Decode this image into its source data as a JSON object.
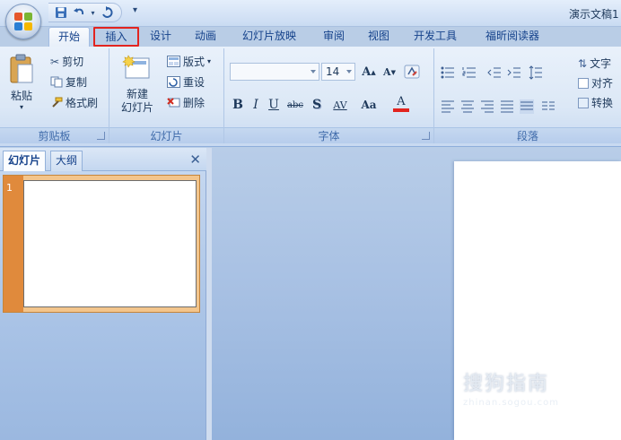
{
  "app": {
    "document_title": "演示文稿1",
    "quick_access": [
      "save-icon",
      "undo-icon",
      "redo-icon",
      "customize-qat-icon"
    ]
  },
  "tabs": [
    {
      "label": "开始",
      "active": true
    },
    {
      "label": "插入",
      "highlighted": true
    },
    {
      "label": "设计"
    },
    {
      "label": "动画"
    },
    {
      "label": "幻灯片放映"
    },
    {
      "label": "审阅"
    },
    {
      "label": "视图"
    },
    {
      "label": "开发工具"
    },
    {
      "label": "福昕阅读器"
    }
  ],
  "ribbon": {
    "clipboard": {
      "group_label": "剪贴板",
      "paste_label": "粘贴",
      "cut_label": "剪切",
      "copy_label": "复制",
      "format_painter_label": "格式刷"
    },
    "slides": {
      "group_label": "幻灯片",
      "new_slide_line1": "新建",
      "new_slide_line2": "幻灯片",
      "layout_label": "版式",
      "reset_label": "重设",
      "delete_label": "删除"
    },
    "font": {
      "group_label": "字体",
      "font_name_value": "",
      "font_size_value": "14",
      "grow_label": "A",
      "shrink_label": "A",
      "bold": "B",
      "italic": "I",
      "underline": "U",
      "strike": "abc",
      "shadow": "S",
      "spacing": "AV",
      "change_case": "Aa",
      "font_color": "A"
    },
    "paragraph": {
      "group_label": "段落",
      "text_direction_label": "文字",
      "align_text_label": "对齐",
      "convert_label": "转换"
    }
  },
  "left_pane": {
    "tab_slides": "幻灯片",
    "tab_outline": "大纲",
    "close_glyph": "✕",
    "slide_numbers": [
      "1"
    ]
  },
  "watermark": {
    "text_cn": "搜狗指南",
    "text_en": "zhinan.sogou.com"
  },
  "colors": {
    "highlight_border": "#e2241f",
    "thumbnail_orange": "#e08a3c",
    "ribbon_text": "#15428b"
  }
}
